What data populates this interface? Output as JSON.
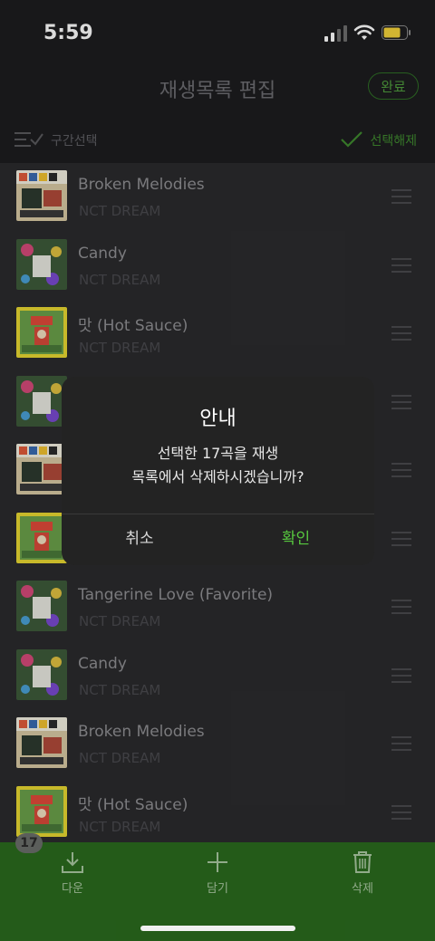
{
  "status": {
    "time": "5:59"
  },
  "header": {
    "title": "재생목록 편집",
    "done_label": "완료"
  },
  "toolbar": {
    "range_select_label": "구간선택",
    "deselect_label": "선택해제"
  },
  "tracks": [
    {
      "title": "Broken Melodies",
      "artist": "NCT DREAM",
      "cover": "broken"
    },
    {
      "title": "Candy",
      "artist": "NCT DREAM",
      "cover": "candy"
    },
    {
      "title": "맛 (Hot Sauce)",
      "artist": "NCT DREAM",
      "cover": "hotsauce"
    },
    {
      "title": "",
      "artist": "",
      "cover": "candy"
    },
    {
      "title": "",
      "artist": "",
      "cover": "broken"
    },
    {
      "title": "",
      "artist": "",
      "cover": "hotsauce"
    },
    {
      "title": "Tangerine Love (Favorite)",
      "artist": "NCT DREAM",
      "cover": "candy"
    },
    {
      "title": "Candy",
      "artist": "NCT DREAM",
      "cover": "candy"
    },
    {
      "title": "Broken Melodies",
      "artist": "NCT DREAM",
      "cover": "broken"
    },
    {
      "title": "맛 (Hot Sauce)",
      "artist": "NCT DREAM",
      "cover": "hotsauce"
    }
  ],
  "dialog": {
    "title": "안내",
    "message_line1": "선택한 17곡을 재생",
    "message_line2": "목록에서 삭제하시겠습니까?",
    "cancel_label": "취소",
    "confirm_label": "확인"
  },
  "bottom_bar": {
    "selected_count": "17",
    "download_label": "다운",
    "add_label": "담기",
    "delete_label": "삭제"
  },
  "colors": {
    "accent_green": "#57c83f",
    "bottom_bar_bg": "#2a6a1e",
    "list_bg": "#2b2b2d"
  }
}
